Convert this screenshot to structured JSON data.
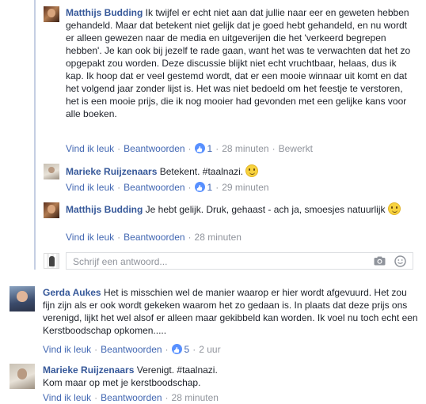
{
  "reply_thread": {
    "replies": [
      {
        "author": "Matthijs Budding",
        "text": "Ik twijfel er echt niet aan dat jullie naar eer en geweten hebben gehandeld. Maar dat betekent niet gelijk dat je goed hebt gehandeld, en nu wordt er alleen gewezen naar de media en uitgeverijen die het 'verkeerd begrepen hebben'. Je kan ook bij jezelf te rade gaan, want het was te verwachten dat het zo opgepakt zou worden. Deze discussie blijkt niet echt vruchtbaar, helaas, dus ik kap. Ik hoop dat er veel gestemd wordt, dat er een mooie winnaar uit komt en dat het volgend jaar zonder lijst is. Het was niet bedoeld om het feestje te verstoren, het is een mooie prijs, die ik nog mooier had gevonden met een gelijke kans voor alle boeken.",
        "like_label": "Vind ik leuk",
        "reply_label": "Beantwoorden",
        "likes": "1",
        "time": "28 minuten",
        "edited": "Bewerkt"
      },
      {
        "author": "Marieke Ruijzenaars",
        "text": "Betekent. #taalnazi.",
        "like_label": "Vind ik leuk",
        "reply_label": "Beantwoorden",
        "likes": "1",
        "time": "29 minuten"
      },
      {
        "author": "Matthijs Budding",
        "text": "Je hebt gelijk. Druk, gehaast - ach ja, smoesjes natuurlijk",
        "like_label": "Vind ik leuk",
        "reply_label": "Beantwoorden",
        "time": "28 minuten"
      }
    ],
    "input_placeholder": "Schrijf een antwoord..."
  },
  "comments": [
    {
      "author": "Gerda Aukes",
      "text": "Het is misschien wel de manier waarop er hier wordt afgevuurd. Het zou fijn zijn als er ook wordt gekeken waarom het zo gedaan is. In plaats dat deze prijs ons verenigd, lijkt het wel alsof er alleen maar gekibbeld kan worden. Ik voel nu toch echt een Kerstboodschap opkomen.....",
      "like_label": "Vind ik leuk",
      "reply_label": "Beantwoorden",
      "likes": "5",
      "time": "2 uur"
    },
    {
      "author": "Marieke Ruijzenaars",
      "text": "Verenigt. #taalnazi.\nKom maar op met je kerstboodschap.",
      "like_label": "Vind ik leuk",
      "reply_label": "Beantwoorden",
      "time": "28 minuten"
    }
  ],
  "colors": {
    "link": "#4267b2",
    "author": "#365899",
    "meta": "#90949c",
    "thread_bar": "#c5cfe3"
  }
}
